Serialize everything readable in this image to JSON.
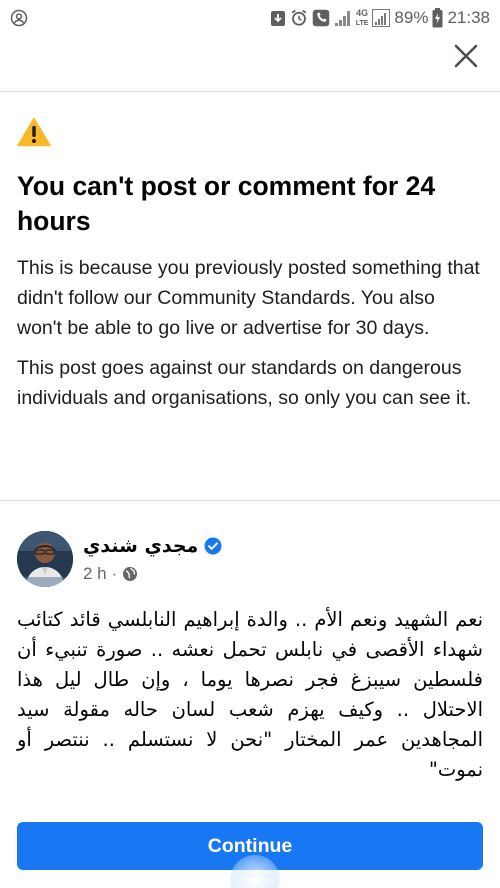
{
  "status_bar": {
    "network_type": "4G",
    "network_sub": "LTE",
    "battery": "89%",
    "time": "21:38",
    "icons": [
      "account-circle-icon",
      "download-icon",
      "alarm-icon",
      "phone-icon",
      "signal-icon",
      "wifi-signal-icon",
      "battery-icon"
    ]
  },
  "dialog": {
    "close_icon": "close-icon",
    "warning_icon": "warning-icon",
    "title": "You can't post or comment for 24 hours",
    "body_1": "This is because you previously posted something that didn't follow our Community Standards. You also won't be able to go live or advertise for 30 days.",
    "body_2": "This post goes against our standards on dangerous individuals and organisations, so only you can see it."
  },
  "post": {
    "author": "مجدي شندي",
    "verified": true,
    "time": "2 h",
    "separator": "·",
    "audience_icon": "globe-icon",
    "text": "نعم الشهيد ونعم الأم .. والدة إبراهيم النابلسي قائد كتائب شهداء الأقصى في نابلس تحمل نعشه .. صورة تنبيء أن فلسطين سيبزغ فجر نصرها يوما ، وإن طال ليل هذا الاحتلال .. وكيف يهزم شعب لسان حاله مقولة سيد المجاهدين عمر المختار \"نحن لا نستسلم .. ننتصر أو نموت\""
  },
  "actions": {
    "continue_label": "Continue"
  },
  "colors": {
    "primary": "#1877f2",
    "warning": "#f7b928",
    "divider": "#dadde1",
    "secondary_text": "#65676b"
  }
}
